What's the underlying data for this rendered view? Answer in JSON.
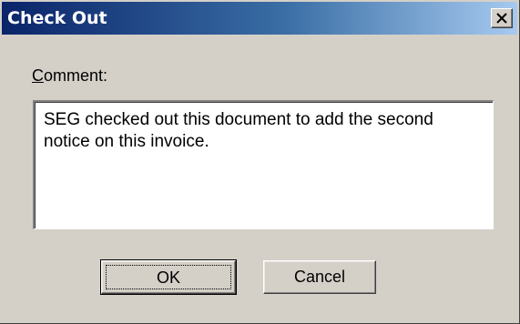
{
  "window": {
    "title": "Check Out"
  },
  "comment": {
    "label_mnemonic": "C",
    "label_rest": "omment:",
    "value": "SEG checked out this document to add the second notice on this invoice."
  },
  "buttons": {
    "ok_label": "OK",
    "cancel_label": "Cancel"
  },
  "icons": {
    "close": "close-icon"
  },
  "colors": {
    "titlebar_start": "#0a246a",
    "titlebar_end": "#a6caf0",
    "face": "#d4d0c8"
  }
}
